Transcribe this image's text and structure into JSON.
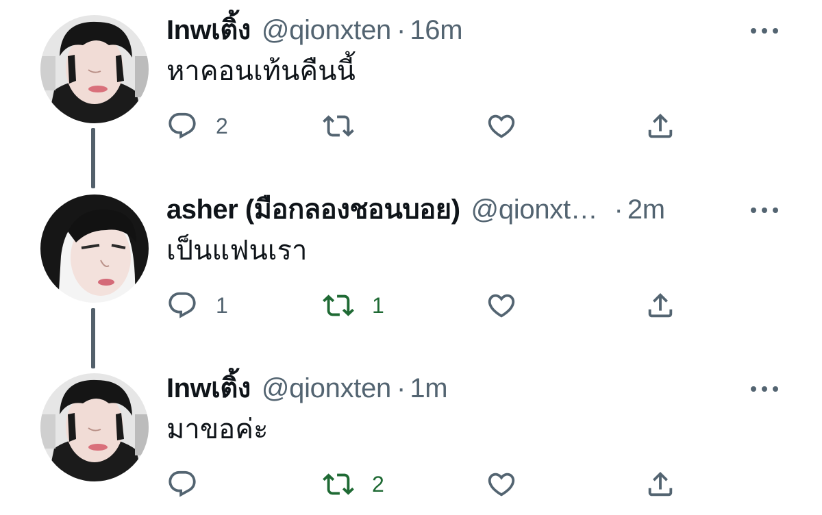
{
  "colors": {
    "text_primary": "#0f1419",
    "text_secondary": "#536471",
    "retweet_active": "#1f6a34",
    "thread_line": "#53606b",
    "background": "#ffffff"
  },
  "tweets": [
    {
      "display_name": "Inwเติ้ง",
      "handle": "@qionxten",
      "dot": "·",
      "time": "16m",
      "text": "หาคอนเท้นคืนนี้",
      "reply_count": "2",
      "retweet_count": "",
      "retweet_active": false,
      "like_count": "",
      "more_icon": "more-options-icon",
      "avatar": "avatar-dark-hair"
    },
    {
      "display_name": "asher (มือกลองชอนบอย)",
      "handle": "@qionxt…",
      "dot": "·",
      "time": "2m",
      "text": "เป็นแฟนเรา",
      "reply_count": "1",
      "retweet_count": "1",
      "retweet_active": true,
      "like_count": "",
      "more_icon": "more-options-icon",
      "avatar": "avatar-portrait"
    },
    {
      "display_name": "Inwเติ้ง",
      "handle": "@qionxten",
      "dot": "·",
      "time": "1m",
      "text": "มาขอค่ะ",
      "reply_count": "",
      "retweet_count": "2",
      "retweet_active": true,
      "like_count": "",
      "more_icon": "more-options-icon",
      "avatar": "avatar-dark-hair"
    }
  ],
  "icons": {
    "reply": "reply-icon",
    "retweet": "retweet-icon",
    "like": "heart-icon",
    "share": "share-icon"
  }
}
